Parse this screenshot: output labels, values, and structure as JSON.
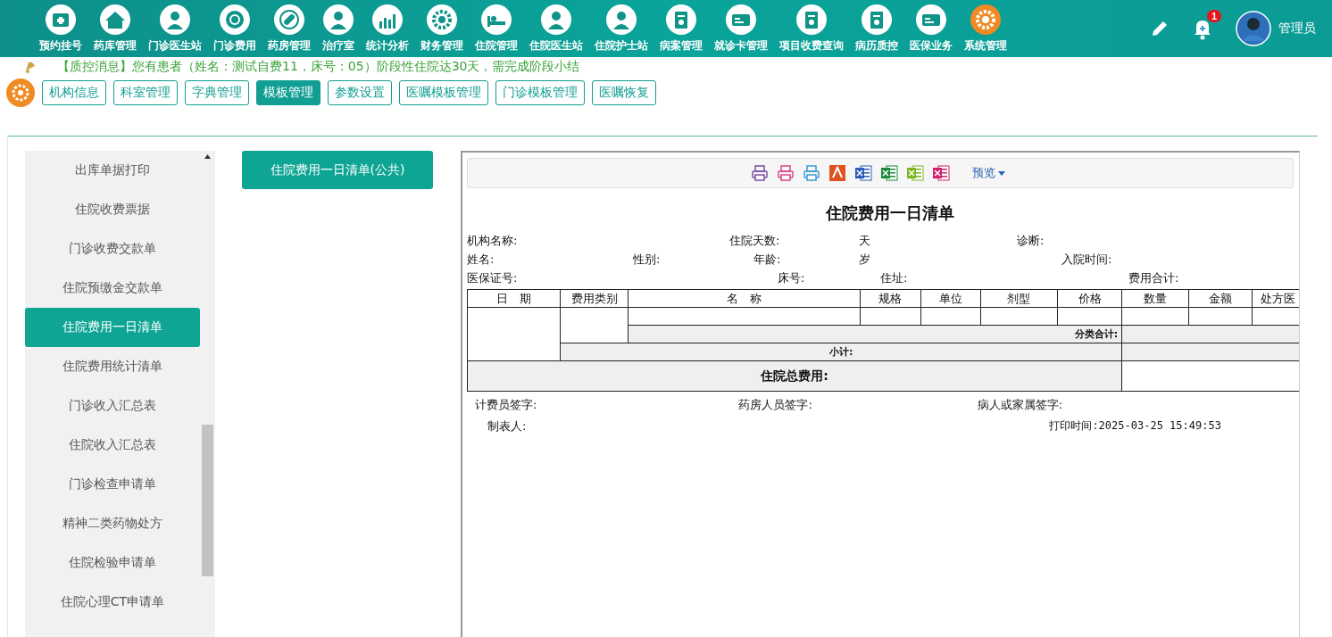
{
  "nav": [
    {
      "label": "预约挂号",
      "selected": false
    },
    {
      "label": "药库管理",
      "selected": false
    },
    {
      "label": "门诊医生站",
      "selected": false
    },
    {
      "label": "门诊费用",
      "selected": false
    },
    {
      "label": "药房管理",
      "selected": false
    },
    {
      "label": "治疗室",
      "selected": false
    },
    {
      "label": "统计分析",
      "selected": false
    },
    {
      "label": "财务管理",
      "selected": false
    },
    {
      "label": "住院管理",
      "selected": false
    },
    {
      "label": "住院医生站",
      "selected": false
    },
    {
      "label": "住院护士站",
      "selected": false
    },
    {
      "label": "病案管理",
      "selected": false
    },
    {
      "label": "就诊卡管理",
      "selected": false
    },
    {
      "label": "项目收费查询",
      "selected": false
    },
    {
      "label": "病历质控",
      "selected": false
    },
    {
      "label": "医保业务",
      "selected": false
    },
    {
      "label": "系统管理",
      "selected": true
    }
  ],
  "notification_count": "1",
  "user": "管理员",
  "notice": "【质控消息】您有患者（姓名：测试自费11，床号：05）阶段性住院达30天，需完成阶段小结",
  "tabs": [
    {
      "label": "机构信息",
      "selected": false
    },
    {
      "label": "科室管理",
      "selected": false
    },
    {
      "label": "字典管理",
      "selected": false
    },
    {
      "label": "模板管理",
      "selected": true
    },
    {
      "label": "参数设置",
      "selected": false
    },
    {
      "label": "医嘱模板管理",
      "selected": false
    },
    {
      "label": "门诊模板管理",
      "selected": false
    },
    {
      "label": "医嘱恢复",
      "selected": false
    }
  ],
  "templates": [
    {
      "label": "出库单据打印",
      "selected": false
    },
    {
      "label": "住院收费票据",
      "selected": false
    },
    {
      "label": "门诊收费交款单",
      "selected": false
    },
    {
      "label": "住院预缴金交款单",
      "selected": false
    },
    {
      "label": "住院费用一日清单",
      "selected": true
    },
    {
      "label": "住院费用统计清单",
      "selected": false
    },
    {
      "label": "门诊收入汇总表",
      "selected": false
    },
    {
      "label": "住院收入汇总表",
      "selected": false
    },
    {
      "label": "门诊检查申请单",
      "selected": false
    },
    {
      "label": "精神二类药物处方",
      "selected": false
    },
    {
      "label": "住院检验申请单",
      "selected": false
    },
    {
      "label": "住院心理CT申请单",
      "selected": false
    }
  ],
  "variant_button": "住院费用一日清单(公共)",
  "report": {
    "preview_label": "预览",
    "title": "住院费用一日清单",
    "info_rows": [
      [
        "机构名称:",
        "住院天数:",
        "天",
        "诊断:"
      ],
      [
        "姓名:",
        "性别:",
        "年龄:",
        "岁",
        "入院时间:"
      ],
      [
        "医保证号:",
        "床号:",
        "住址:",
        "费用合计:"
      ]
    ],
    "columns": [
      "日　期",
      "费用类别",
      "名　称",
      "规格",
      "单位",
      "剂型",
      "价格",
      "数量",
      "金额",
      "处方医"
    ],
    "category_total": "分类合计:",
    "subtotal": "小计:",
    "grand_total": "住院总费用:",
    "signatures": [
      "计费员签字:",
      "药房人员签字:",
      "病人或家属签字:"
    ],
    "maker": "制表人:",
    "print_time": "打印时间:2025-03-25 15:49:53"
  }
}
